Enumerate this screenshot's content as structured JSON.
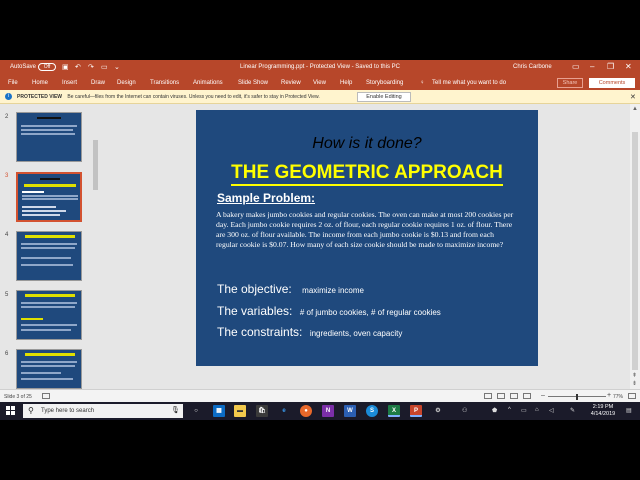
{
  "window": {
    "autosave_label": "AutoSave",
    "autosave_state": "Off",
    "document_title": "Linear Programming.ppt - Protected View - Saved to this PC",
    "user_name": "Chris Carbone",
    "accent_color": "#b7472a"
  },
  "menu": {
    "items": [
      "File",
      "Home",
      "Insert",
      "Draw",
      "Design",
      "Transitions",
      "Animations",
      "Slide Show",
      "Review",
      "View",
      "Help",
      "Storyboarding"
    ],
    "tell_me": "Tell me what you want to do",
    "share": "Share",
    "comments": "Comments"
  },
  "protected": {
    "label": "PROTECTED VIEW",
    "message": "Be careful—files from the Internet can contain viruses. Unless you need to edit, it's safer to stay in Protected View.",
    "enable_button": "Enable Editing"
  },
  "thumbnails": [
    {
      "number": "2",
      "selected": false
    },
    {
      "number": "3",
      "selected": true
    },
    {
      "number": "4",
      "selected": false
    },
    {
      "number": "5",
      "selected": false
    },
    {
      "number": "6",
      "selected": false
    }
  ],
  "slide": {
    "heading": "How is it done?",
    "title": "THE GEOMETRIC APPROACH",
    "sample_label": "Sample Problem:",
    "problem_text": "A bakery makes jumbo cookies and regular cookies.  The oven can make at most 200 cookies per day.  Each jumbo cookie requires 2 oz. of flour, each regular cookie requires 1 oz. of flour.  There are 300 oz. of flour available.  The income from each jumbo cookie is $0.13 and from each regular cookie is $0.07.  How many of each size cookie should be made to maximize income?",
    "objective_label": "The objective:",
    "objective_value": "maximize income",
    "variables_label": "The variables:",
    "variables_value": "# of jumbo cookies, # of regular cookies",
    "constraints_label": "The constraints:",
    "constraints_value": "ingredients, oven capacity",
    "background_color": "#1f497d",
    "title_color": "#ffff00"
  },
  "status": {
    "slide_counter": "Slide 3 of 25",
    "zoom": "77%"
  },
  "taskbar": {
    "search_placeholder": "Type here to search",
    "time": "2:19 PM",
    "date": "4/14/2019"
  }
}
